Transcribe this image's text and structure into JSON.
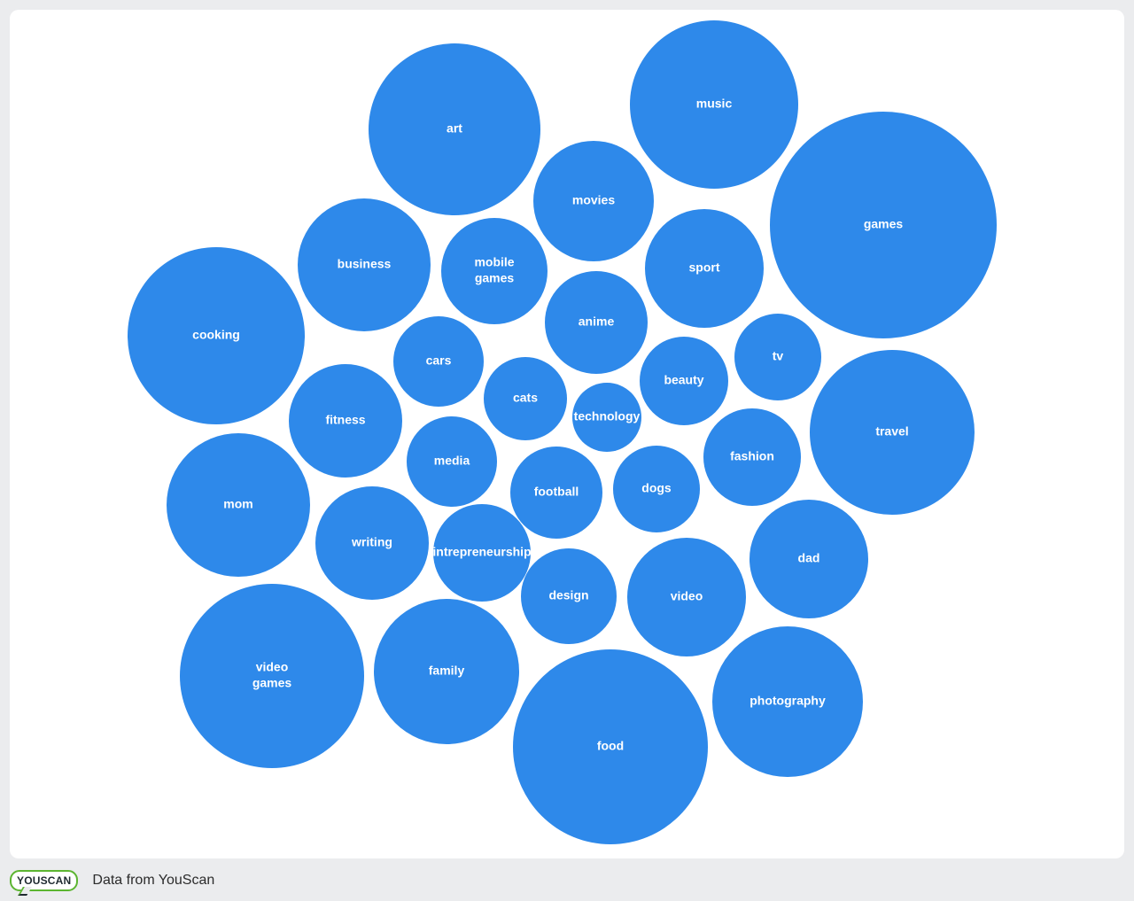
{
  "chart_data": {
    "type": "bubble",
    "title": "",
    "color": "#2e89ea",
    "label_color": "#ffffff",
    "note": "Bubble sizes are relative (radius-proportional) estimates; no numeric values shown.",
    "bubbles": [
      {
        "label": [
          "art"
        ],
        "size": 97
      },
      {
        "label": [
          "music"
        ],
        "size": 95
      },
      {
        "label": [
          "games"
        ],
        "size": 128
      },
      {
        "label": [
          "movies"
        ],
        "size": 68
      },
      {
        "label": [
          "business"
        ],
        "size": 75
      },
      {
        "label": [
          "mobile",
          "games"
        ],
        "size": 60
      },
      {
        "label": [
          "sport"
        ],
        "size": 67
      },
      {
        "label": [
          "cooking"
        ],
        "size": 100
      },
      {
        "label": [
          "anime"
        ],
        "size": 58
      },
      {
        "label": [
          "tv"
        ],
        "size": 49
      },
      {
        "label": [
          "cars"
        ],
        "size": 51
      },
      {
        "label": [
          "beauty"
        ],
        "size": 50
      },
      {
        "label": [
          "cats"
        ],
        "size": 47
      },
      {
        "label": [
          "technology"
        ],
        "size": 39
      },
      {
        "label": [
          "fitness"
        ],
        "size": 64
      },
      {
        "label": [
          "travel"
        ],
        "size": 93
      },
      {
        "label": [
          "fashion"
        ],
        "size": 55
      },
      {
        "label": [
          "media"
        ],
        "size": 51
      },
      {
        "label": [
          "football"
        ],
        "size": 52
      },
      {
        "label": [
          "dogs"
        ],
        "size": 49
      },
      {
        "label": [
          "mom"
        ],
        "size": 81
      },
      {
        "label": [
          "writing"
        ],
        "size": 64
      },
      {
        "label": [
          "intrepreneurship"
        ],
        "size": 55
      },
      {
        "label": [
          "dad"
        ],
        "size": 67
      },
      {
        "label": [
          "design"
        ],
        "size": 54
      },
      {
        "label": [
          "video"
        ],
        "size": 67
      },
      {
        "label": [
          "video",
          "games"
        ],
        "size": 104
      },
      {
        "label": [
          "family"
        ],
        "size": 82
      },
      {
        "label": [
          "photography"
        ],
        "size": 85
      },
      {
        "label": [
          "food"
        ],
        "size": 110
      }
    ]
  },
  "footer": {
    "logo_text": "YOUSCAN",
    "source_text": "Data from YouScan"
  }
}
